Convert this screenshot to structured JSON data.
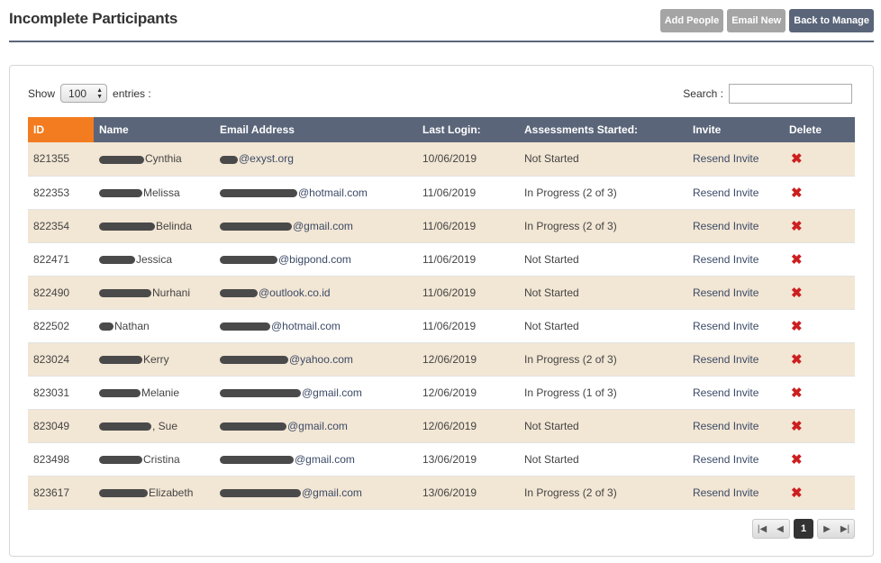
{
  "header": {
    "title": "Incomplete Participants",
    "buttons": {
      "add_people": "Add People",
      "email_new": "Email New",
      "back_to_manage": "Back to Manage"
    }
  },
  "controls": {
    "show_label": "Show",
    "entries_value": "100",
    "entries_label": "entries :",
    "search_label": "Search :",
    "search_value": ""
  },
  "table": {
    "columns": [
      "ID",
      "Name",
      "Email Address",
      "Last Login:",
      "Assessments Started:",
      "Invite",
      "Delete"
    ],
    "rows": [
      {
        "id": "821355",
        "name": "Cynthia",
        "email": "@exyst.org",
        "last_login": "10/06/2019",
        "status": "Not Started",
        "invite": "Resend Invite"
      },
      {
        "id": "822353",
        "name": "Melissa",
        "email": "@hotmail.com",
        "last_login": "11/06/2019",
        "status": "In Progress (2 of 3)",
        "invite": "Resend Invite"
      },
      {
        "id": "822354",
        "name": "Belinda",
        "email": "@gmail.com",
        "last_login": "11/06/2019",
        "status": "In Progress (2 of 3)",
        "invite": "Resend Invite"
      },
      {
        "id": "822471",
        "name": "Jessica",
        "email": "@bigpond.com",
        "last_login": "11/06/2019",
        "status": "Not Started",
        "invite": "Resend Invite"
      },
      {
        "id": "822490",
        "name": "Nurhani",
        "email": "@outlook.co.id",
        "last_login": "11/06/2019",
        "status": "Not Started",
        "invite": "Resend Invite"
      },
      {
        "id": "822502",
        "name": "Nathan",
        "email": "@hotmail.com",
        "last_login": "11/06/2019",
        "status": "Not Started",
        "invite": "Resend Invite"
      },
      {
        "id": "823024",
        "name": "Kerry",
        "email": "@yahoo.com",
        "last_login": "12/06/2019",
        "status": "In Progress (2 of 3)",
        "invite": "Resend Invite"
      },
      {
        "id": "823031",
        "name": "Melanie",
        "email": "@gmail.com",
        "last_login": "12/06/2019",
        "status": "In Progress (1 of 3)",
        "invite": "Resend Invite"
      },
      {
        "id": "823049",
        "name": ", Sue",
        "email": "@gmail.com",
        "last_login": "12/06/2019",
        "status": "Not Started",
        "invite": "Resend Invite"
      },
      {
        "id": "823498",
        "name": "Cristina",
        "email": "@gmail.com",
        "last_login": "13/06/2019",
        "status": "Not Started",
        "invite": "Resend Invite"
      },
      {
        "id": "823617",
        "name": "Elizabeth",
        "email": "@gmail.com",
        "last_login": "13/06/2019",
        "status": "In Progress (2 of 3)",
        "invite": "Resend Invite"
      }
    ]
  },
  "pagination": {
    "current_page": "1"
  },
  "colors": {
    "header_bar": "#5a6579",
    "id_header": "#f47c20",
    "row_odd": "#f2e6d4",
    "delete_icon": "#cc1f1f"
  },
  "icons": {
    "delete": "close-x-icon",
    "first": "first-page-icon",
    "prev": "prev-page-icon",
    "next": "next-page-icon",
    "last": "last-page-icon"
  }
}
